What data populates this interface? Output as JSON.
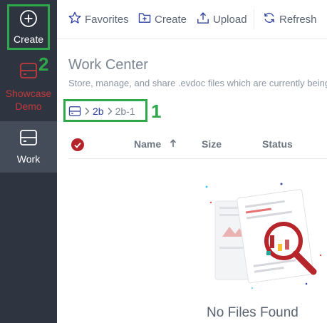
{
  "sidebar": {
    "create_label": "Create",
    "showcase_label": "Showcase Demo",
    "work_label": "Work"
  },
  "toolbar": {
    "favorites": "Favorites",
    "create": "Create",
    "upload": "Upload",
    "refresh": "Refresh"
  },
  "page": {
    "title": "Work Center",
    "subtitle": "Store, manage, and share .evdoc files which are currently being worked on"
  },
  "breadcrumb": {
    "items": [
      "2b",
      "2b-1"
    ]
  },
  "table": {
    "columns": [
      "Name",
      "Size",
      "Status"
    ]
  },
  "empty_state": {
    "message": "No Files Found"
  },
  "annotations": {
    "breadcrumb_number": "1",
    "create_number": "2"
  },
  "colors": {
    "sidebar_bg": "#2e3540",
    "accent_red": "#b5252a",
    "highlight_green": "#2ea84a",
    "link_blue": "#2c3e9e"
  }
}
